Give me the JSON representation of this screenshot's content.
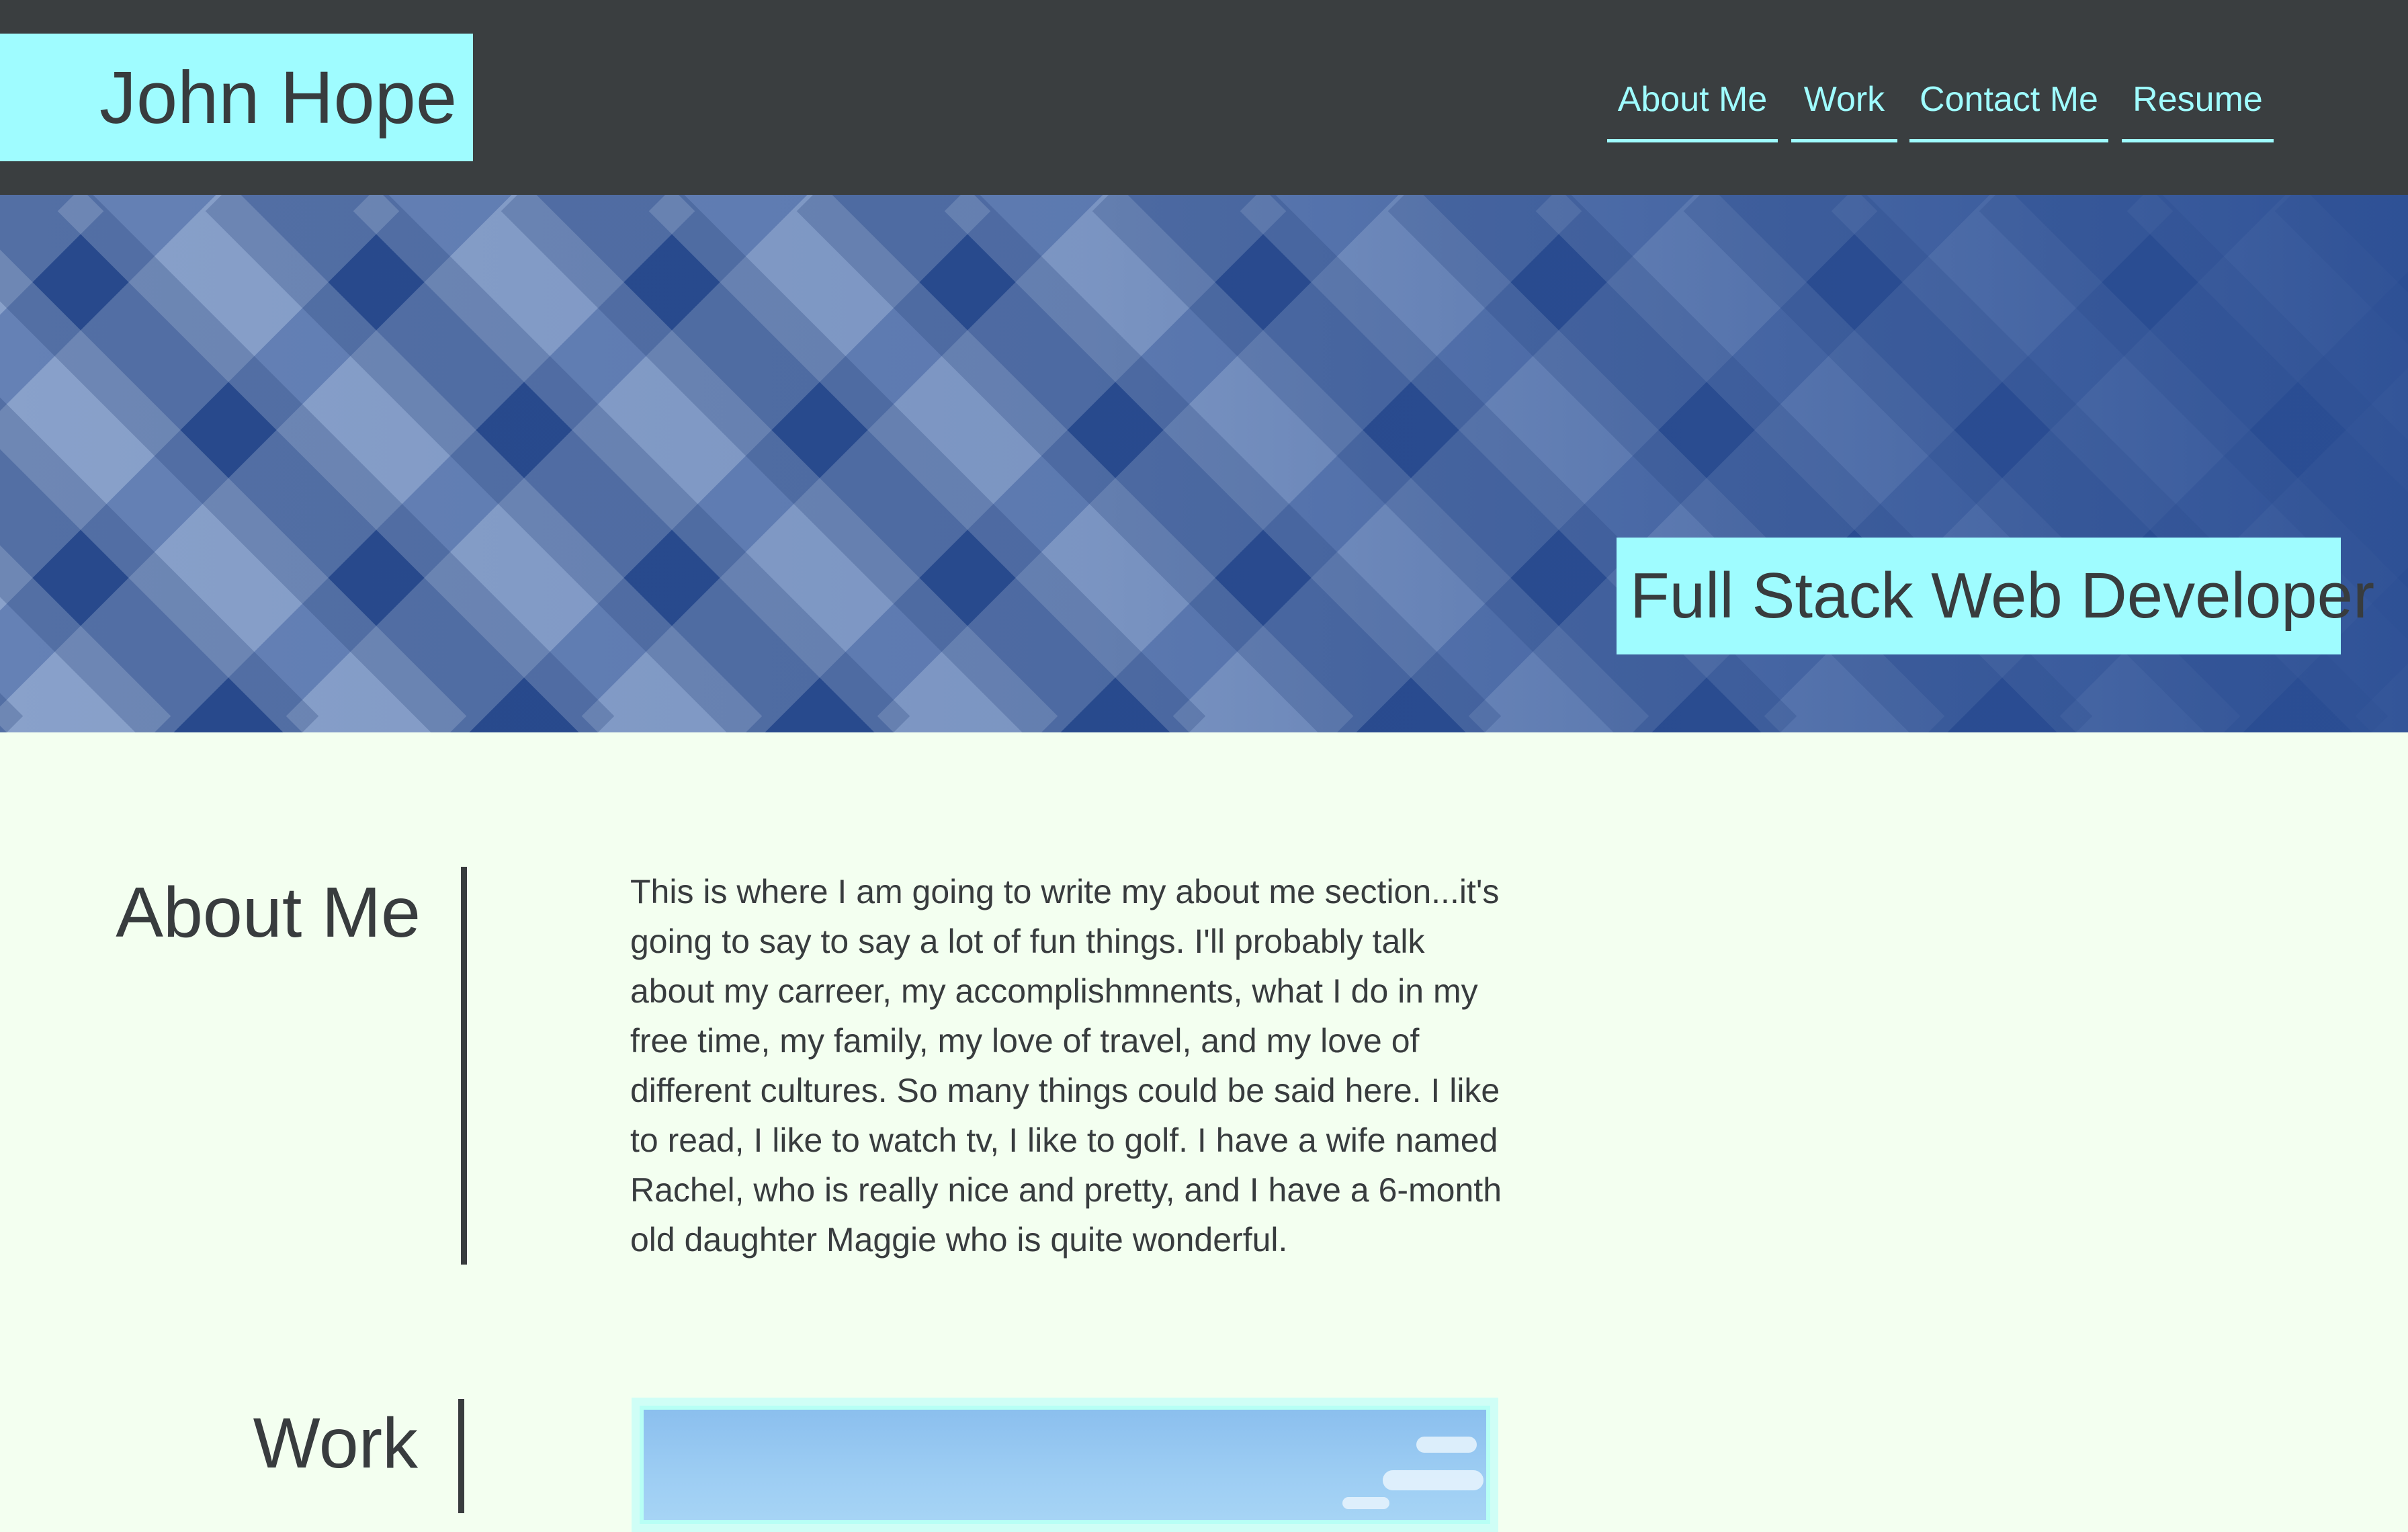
{
  "header": {
    "name": "John Hope",
    "nav": [
      {
        "label": "About Me"
      },
      {
        "label": "Work"
      },
      {
        "label": "Contact Me"
      },
      {
        "label": "Resume"
      }
    ]
  },
  "hero": {
    "tagline": "Full Stack Web Developer"
  },
  "about": {
    "title": "About Me",
    "body": "This is where I am going to write my about me section...it's going to say to say a lot of fun things. I'll probably talk about my carreer, my accomplishmnents, what I do in my free time, my family, my love of travel, and my love of different cultures. So many things could be said here. I like to read, I like to watch tv, I like to golf. I have a wife named Rachel, who is really nice and pretty, and I have a 6-month old daughter Maggie who is quite wonderful."
  },
  "work": {
    "title": "Work"
  },
  "colors": {
    "accent": "#9ffcff",
    "header_bg": "#3a3e40",
    "page_bg": "#f3fff0",
    "text": "#383c3e",
    "hero_blue": "#2b4e94"
  }
}
